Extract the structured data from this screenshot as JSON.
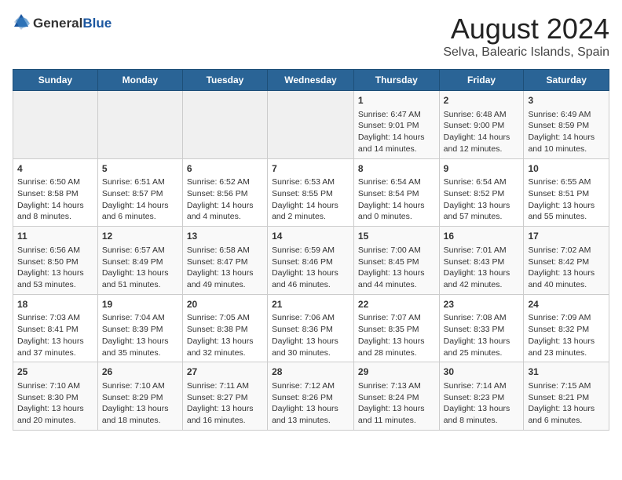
{
  "logo": {
    "general": "General",
    "blue": "Blue"
  },
  "title": "August 2024",
  "subtitle": "Selva, Balearic Islands, Spain",
  "days_of_week": [
    "Sunday",
    "Monday",
    "Tuesday",
    "Wednesday",
    "Thursday",
    "Friday",
    "Saturday"
  ],
  "weeks": [
    [
      {
        "day": "",
        "empty": true
      },
      {
        "day": "",
        "empty": true
      },
      {
        "day": "",
        "empty": true
      },
      {
        "day": "",
        "empty": true
      },
      {
        "day": "1",
        "sunrise": "6:47 AM",
        "sunset": "9:01 PM",
        "daylight": "14 hours and 14 minutes."
      },
      {
        "day": "2",
        "sunrise": "6:48 AM",
        "sunset": "9:00 PM",
        "daylight": "14 hours and 12 minutes."
      },
      {
        "day": "3",
        "sunrise": "6:49 AM",
        "sunset": "8:59 PM",
        "daylight": "14 hours and 10 minutes."
      }
    ],
    [
      {
        "day": "4",
        "sunrise": "6:50 AM",
        "sunset": "8:58 PM",
        "daylight": "14 hours and 8 minutes."
      },
      {
        "day": "5",
        "sunrise": "6:51 AM",
        "sunset": "8:57 PM",
        "daylight": "14 hours and 6 minutes."
      },
      {
        "day": "6",
        "sunrise": "6:52 AM",
        "sunset": "8:56 PM",
        "daylight": "14 hours and 4 minutes."
      },
      {
        "day": "7",
        "sunrise": "6:53 AM",
        "sunset": "8:55 PM",
        "daylight": "14 hours and 2 minutes."
      },
      {
        "day": "8",
        "sunrise": "6:54 AM",
        "sunset": "8:54 PM",
        "daylight": "14 hours and 0 minutes."
      },
      {
        "day": "9",
        "sunrise": "6:54 AM",
        "sunset": "8:52 PM",
        "daylight": "13 hours and 57 minutes."
      },
      {
        "day": "10",
        "sunrise": "6:55 AM",
        "sunset": "8:51 PM",
        "daylight": "13 hours and 55 minutes."
      }
    ],
    [
      {
        "day": "11",
        "sunrise": "6:56 AM",
        "sunset": "8:50 PM",
        "daylight": "13 hours and 53 minutes."
      },
      {
        "day": "12",
        "sunrise": "6:57 AM",
        "sunset": "8:49 PM",
        "daylight": "13 hours and 51 minutes."
      },
      {
        "day": "13",
        "sunrise": "6:58 AM",
        "sunset": "8:47 PM",
        "daylight": "13 hours and 49 minutes."
      },
      {
        "day": "14",
        "sunrise": "6:59 AM",
        "sunset": "8:46 PM",
        "daylight": "13 hours and 46 minutes."
      },
      {
        "day": "15",
        "sunrise": "7:00 AM",
        "sunset": "8:45 PM",
        "daylight": "13 hours and 44 minutes."
      },
      {
        "day": "16",
        "sunrise": "7:01 AM",
        "sunset": "8:43 PM",
        "daylight": "13 hours and 42 minutes."
      },
      {
        "day": "17",
        "sunrise": "7:02 AM",
        "sunset": "8:42 PM",
        "daylight": "13 hours and 40 minutes."
      }
    ],
    [
      {
        "day": "18",
        "sunrise": "7:03 AM",
        "sunset": "8:41 PM",
        "daylight": "13 hours and 37 minutes."
      },
      {
        "day": "19",
        "sunrise": "7:04 AM",
        "sunset": "8:39 PM",
        "daylight": "13 hours and 35 minutes."
      },
      {
        "day": "20",
        "sunrise": "7:05 AM",
        "sunset": "8:38 PM",
        "daylight": "13 hours and 32 minutes."
      },
      {
        "day": "21",
        "sunrise": "7:06 AM",
        "sunset": "8:36 PM",
        "daylight": "13 hours and 30 minutes."
      },
      {
        "day": "22",
        "sunrise": "7:07 AM",
        "sunset": "8:35 PM",
        "daylight": "13 hours and 28 minutes."
      },
      {
        "day": "23",
        "sunrise": "7:08 AM",
        "sunset": "8:33 PM",
        "daylight": "13 hours and 25 minutes."
      },
      {
        "day": "24",
        "sunrise": "7:09 AM",
        "sunset": "8:32 PM",
        "daylight": "13 hours and 23 minutes."
      }
    ],
    [
      {
        "day": "25",
        "sunrise": "7:10 AM",
        "sunset": "8:30 PM",
        "daylight": "13 hours and 20 minutes."
      },
      {
        "day": "26",
        "sunrise": "7:10 AM",
        "sunset": "8:29 PM",
        "daylight": "13 hours and 18 minutes."
      },
      {
        "day": "27",
        "sunrise": "7:11 AM",
        "sunset": "8:27 PM",
        "daylight": "13 hours and 16 minutes."
      },
      {
        "day": "28",
        "sunrise": "7:12 AM",
        "sunset": "8:26 PM",
        "daylight": "13 hours and 13 minutes."
      },
      {
        "day": "29",
        "sunrise": "7:13 AM",
        "sunset": "8:24 PM",
        "daylight": "13 hours and 11 minutes."
      },
      {
        "day": "30",
        "sunrise": "7:14 AM",
        "sunset": "8:23 PM",
        "daylight": "13 hours and 8 minutes."
      },
      {
        "day": "31",
        "sunrise": "7:15 AM",
        "sunset": "8:21 PM",
        "daylight": "13 hours and 6 minutes."
      }
    ]
  ]
}
